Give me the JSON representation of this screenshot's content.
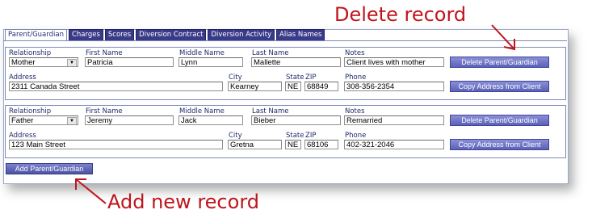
{
  "tabs": [
    {
      "label": "Parent/Guardian",
      "active": true
    },
    {
      "label": "Charges",
      "active": false
    },
    {
      "label": "Scores",
      "active": false
    },
    {
      "label": "Diversion Contract",
      "active": false
    },
    {
      "label": "Diversion Activity",
      "active": false
    },
    {
      "label": "Alias Names",
      "active": false
    }
  ],
  "labels": {
    "relationship": "Relationship",
    "first_name": "First Name",
    "middle_name": "Middle Name",
    "last_name": "Last Name",
    "notes": "Notes",
    "address": "Address",
    "city": "City",
    "state": "State",
    "zip": "ZIP",
    "phone": "Phone"
  },
  "records": [
    {
      "relationship": "Mother",
      "first_name": "Patricia",
      "middle_name": "Lynn",
      "last_name": "Mallette",
      "notes": "Client lives with mother",
      "address": "2311 Canada Street",
      "city": "Kearney",
      "state": "NE",
      "zip": "68849",
      "phone": "308-356-2354"
    },
    {
      "relationship": "Father",
      "first_name": "Jeremy",
      "middle_name": "Jack",
      "last_name": "Bieber",
      "notes": "Remarried",
      "address": "123 Main Street",
      "city": "Gretna",
      "state": "NE",
      "zip": "68106",
      "phone": "402-321-2046"
    }
  ],
  "buttons": {
    "delete": "Delete Parent/Guardian",
    "copy_address": "Copy Address from Client",
    "add": "Add Parent/Guardian"
  },
  "annotations": {
    "delete_record": "Delete record",
    "add_new_record": "Add new record"
  },
  "colors": {
    "annotation": "#c0141b",
    "tab_bg": "#3a3a8a",
    "button": "#5b61b8",
    "label": "#1f2b6b"
  }
}
